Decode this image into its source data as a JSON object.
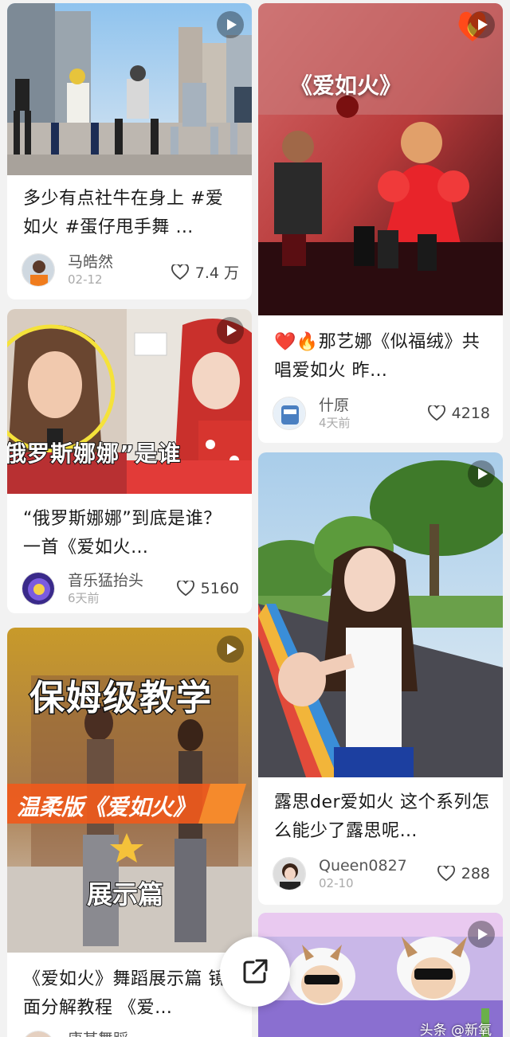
{
  "feed": {
    "cards": [
      {
        "title": "多少有点社牛在身上 #爱如火 #蛋仔甩手舞 …",
        "author": "马皓然",
        "date": "02-12",
        "likes": "7.4 万"
      },
      {
        "overlay": "《爱如火》",
        "title": "❤️🔥那艺娜《似福绒》共唱爱如火 昨…",
        "author": "什原",
        "date": "4天前",
        "likes": "4218"
      },
      {
        "overlay": "俄罗斯娜娜”是谁",
        "title": "“俄罗斯娜娜”到底是谁？ 一首《爱如火…",
        "author": "音乐猛抬头",
        "date": "6天前",
        "likes": "5160"
      },
      {
        "title": "露思der爱如火 这个系列怎么能少了露思呢…",
        "author": "Queen0827",
        "date": "02-10",
        "likes": "288"
      },
      {
        "overlay_top": "保姆级教学",
        "overlay_mid": "温柔版《爱如火》",
        "overlay_bottom": "展示篇",
        "title": "《爱如火》舞蹈展示篇 镜面分解教程 《爱…",
        "author": "康某舞蹈"
      },
      {
        "title": ""
      }
    ]
  },
  "watermark": "头条 @新氧",
  "icons": {
    "play": "play-icon",
    "heart": "heart-outline-icon",
    "share": "share-external-icon",
    "fire": "fire-heart-icon"
  },
  "colors": {
    "background": "#f2f2f2",
    "card": "#ffffff",
    "text": "#1a1a1a",
    "muted": "#aaaaaa"
  }
}
